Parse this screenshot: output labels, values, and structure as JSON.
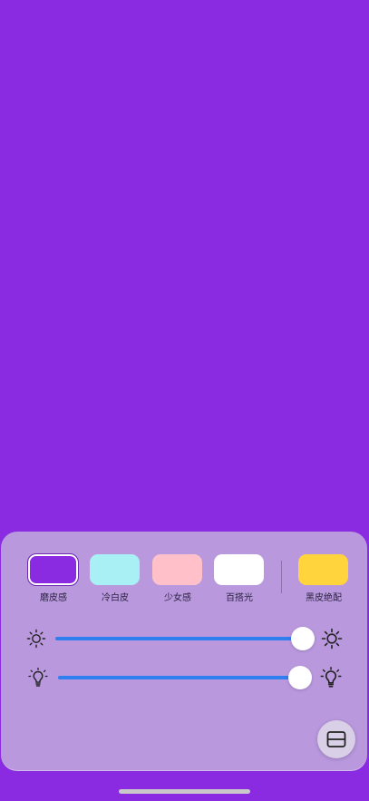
{
  "screen": {
    "fill_color": "#8a2be2"
  },
  "panel": {
    "background": "#b998de",
    "presets": [
      {
        "label": "磨皮感",
        "color": "#8a2be2",
        "selected": true
      },
      {
        "label": "冷白皮",
        "color": "#a9f0f5",
        "selected": false
      },
      {
        "label": "少女感",
        "color": "#ffc0c9",
        "selected": false
      },
      {
        "label": "百搭光",
        "color": "#ffffff",
        "selected": false
      },
      {
        "label": "黑皮绝配",
        "color": "#ffd43c",
        "selected": false
      }
    ],
    "brightness": {
      "icon_left": "sun-small-icon",
      "icon_right": "sun-large-icon",
      "level": 1.0,
      "track_color": "#2f7ff0"
    },
    "warmth": {
      "icon_left": "bulb-small-icon",
      "icon_right": "bulb-large-icon",
      "level": 1.0,
      "track_color": "#2f7ff0"
    },
    "layout_button": {
      "icon": "split-layout-icon"
    }
  }
}
